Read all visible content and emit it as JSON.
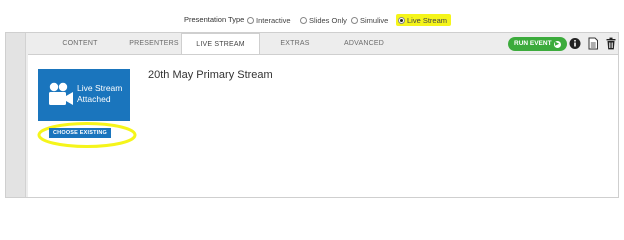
{
  "presentation_type": {
    "label": "Presentation Type",
    "options": [
      {
        "label": "Interactive",
        "selected": false
      },
      {
        "label": "Slides Only",
        "selected": false
      },
      {
        "label": "Simulive",
        "selected": false
      },
      {
        "label": "Live Stream",
        "selected": true
      }
    ]
  },
  "tabs": {
    "content": "CONTENT",
    "presenters": "PRESENTERS",
    "live_stream": "LIVE STREAM",
    "extras": "EXTRAS",
    "advanced": "ADVANCED",
    "active": "LIVE STREAM"
  },
  "toolbar": {
    "run_event_label": "RUN EVENT",
    "icons": [
      "info-icon",
      "document-icon",
      "trash-icon"
    ]
  },
  "stream": {
    "tile_text_line1": "Live Stream",
    "tile_text_line2": "Attached",
    "title": "20th May Primary Stream",
    "choose_existing_label": "CHOOSE EXISTING"
  },
  "colors": {
    "brand_blue": "#1a75bd",
    "run_green": "#3cab3c",
    "highlight_yellow": "#f5f51a"
  }
}
